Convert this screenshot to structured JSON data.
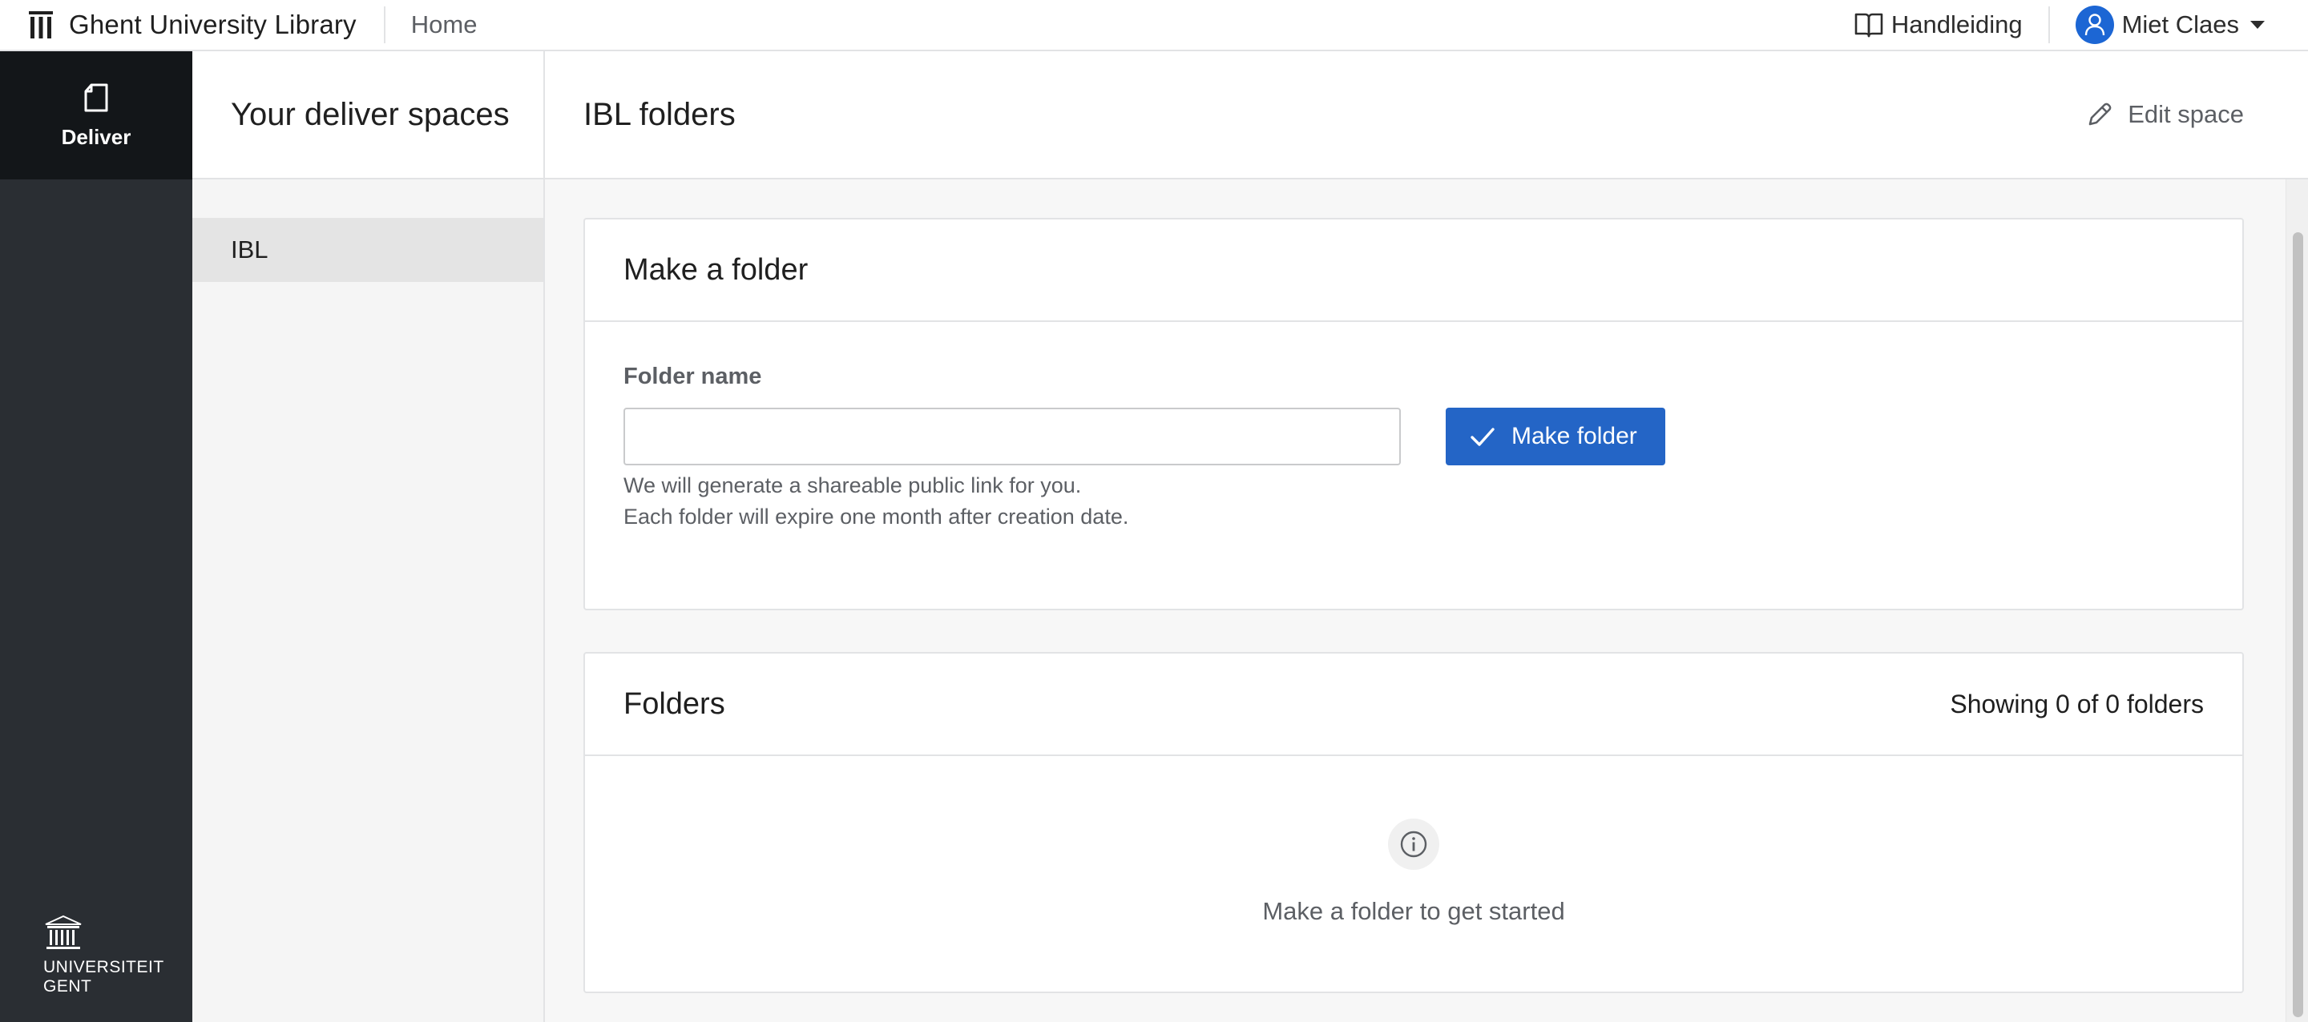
{
  "topbar": {
    "brand": "Ghent University Library",
    "home_link": "Home",
    "manual": "Handleiding",
    "user_name": "Miet Claes"
  },
  "rail": {
    "active_item": "Deliver",
    "logo_line1": "UNIVERSITEIT",
    "logo_line2": "GENT"
  },
  "sidebar": {
    "title": "Your deliver spaces",
    "items": [
      {
        "label": "IBL",
        "selected": true
      }
    ]
  },
  "main": {
    "title": "IBL folders",
    "edit_space": "Edit space"
  },
  "make_folder": {
    "title": "Make a folder",
    "field_label": "Folder name",
    "field_value": "",
    "field_placeholder": "",
    "button_label": "Make folder",
    "hint_line1": "We will generate a shareable public link for you.",
    "hint_line2": "Each folder will expire one month after creation date."
  },
  "folders": {
    "title": "Folders",
    "count": "Showing 0 of 0 folders",
    "empty_message": "Make a folder to get started"
  },
  "colors": {
    "primary": "#2465c6",
    "rail_bg": "#2a2e33",
    "rail_active_bg": "#131619"
  }
}
